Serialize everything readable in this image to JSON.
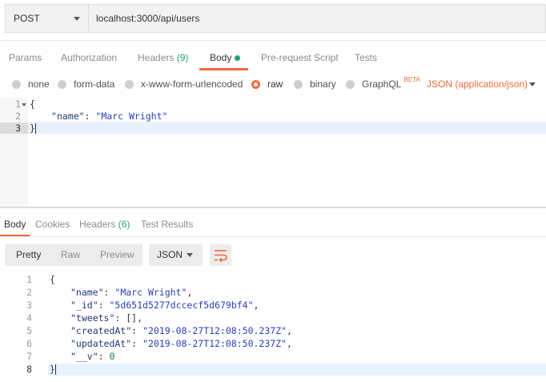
{
  "request": {
    "method": "POST",
    "url": "localhost:3000/api/users"
  },
  "request_tabs": {
    "params": "Params",
    "authorization": "Authorization",
    "headers": "Headers",
    "headers_count": "(9)",
    "body": "Body",
    "prerequest": "Pre-request Script",
    "tests": "Tests"
  },
  "body_types": {
    "none": "none",
    "form_data": "form-data",
    "urlencoded": "x-www-form-urlencoded",
    "raw": "raw",
    "binary": "binary",
    "graphql": "GraphQL",
    "beta": "BETA",
    "content_type": "JSON (application/json)"
  },
  "request_body": {
    "line_numbers": [
      "1",
      "2",
      "3"
    ],
    "open_brace": "{",
    "name_key": "\"name\"",
    "name_value": "\"Marc Wright\"",
    "close_brace": "}"
  },
  "response_tabs": {
    "body": "Body",
    "cookies": "Cookies",
    "headers": "Headers",
    "headers_count": "(6)",
    "test_results": "Test Results"
  },
  "response_toolbar": {
    "pretty": "Pretty",
    "raw": "Raw",
    "preview": "Preview",
    "format": "JSON"
  },
  "response_body": {
    "line_numbers": [
      "1",
      "2",
      "3",
      "4",
      "5",
      "6",
      "7",
      "8"
    ],
    "open_brace": "{",
    "name_key": "\"name\"",
    "name_value": "\"Marc Wright\"",
    "id_key": "\"_id\"",
    "id_value": "\"5d651d5277dccecf5d679bf4\"",
    "tweets_key": "\"tweets\"",
    "tweets_value": "[]",
    "created_key": "\"createdAt\"",
    "created_value": "\"2019-08-27T12:08:50.237Z\"",
    "updated_key": "\"updatedAt\"",
    "updated_value": "\"2019-08-27T12:08:50.237Z\"",
    "v_key": "\"__v\"",
    "v_value": "0",
    "close_brace": "}"
  },
  "colors": {
    "accent": "#f26b3a",
    "count_green": "#26a26b"
  }
}
